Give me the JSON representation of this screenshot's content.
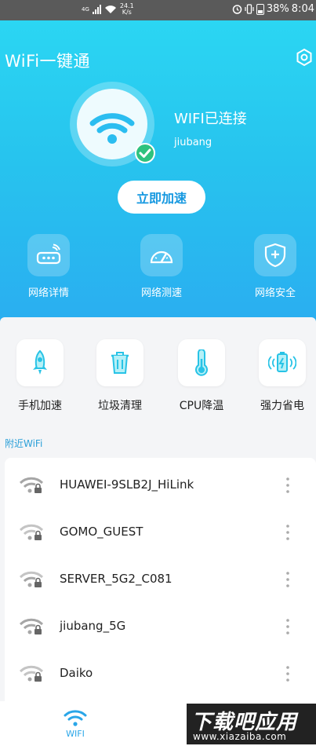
{
  "status_bar": {
    "network_label": "4G",
    "speed_value": "24.1",
    "speed_unit": "K/s",
    "battery": "38%",
    "time": "8:04"
  },
  "header": {
    "title": "WiFi一键通"
  },
  "connection": {
    "status": "WIFI已连接",
    "ssid": "jiubang",
    "boost_label": "立即加速"
  },
  "tools": [
    {
      "label": "网络详情",
      "icon": "router-icon"
    },
    {
      "label": "网络测速",
      "icon": "speedometer-icon"
    },
    {
      "label": "网络安全",
      "icon": "shield-plus-icon"
    }
  ],
  "features": [
    {
      "label": "手机加速",
      "icon": "rocket-icon"
    },
    {
      "label": "垃圾清理",
      "icon": "trash-icon"
    },
    {
      "label": "CPU降温",
      "icon": "thermometer-icon"
    },
    {
      "label": "强力省电",
      "icon": "battery-saver-icon"
    }
  ],
  "nearby": {
    "label": "附近WiFi",
    "networks": [
      {
        "name": "HUAWEI-9SLB2J_HiLink",
        "locked": true
      },
      {
        "name": "GOMO_GUEST",
        "locked": true
      },
      {
        "name": "SERVER_5G2_C081",
        "locked": true
      },
      {
        "name": "jiubang_5G",
        "locked": true
      },
      {
        "name": "Daiko",
        "locked": true
      }
    ]
  },
  "bottom_nav": {
    "wifi_label": "WIFI"
  },
  "watermark": {
    "line1": "下载吧应用",
    "line2": "www.xiazaiba.com"
  },
  "colors": {
    "accent": "#2aaef0",
    "gradient_top": "#2bd6f3",
    "check": "#2ec27e",
    "nearby_label": "#2a9fd8"
  }
}
